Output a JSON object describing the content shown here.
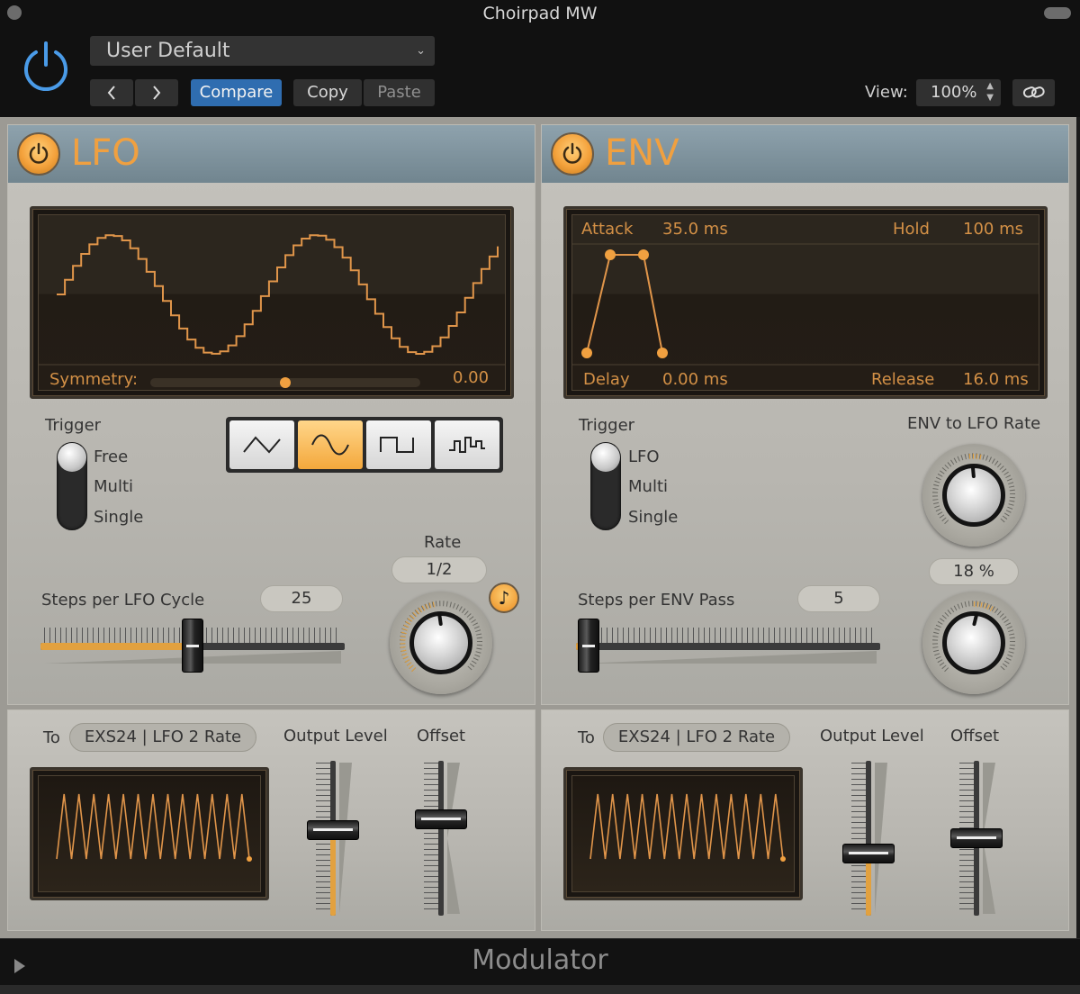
{
  "window": {
    "title": "Choirpad MW"
  },
  "header": {
    "preset": "User Default",
    "prev_icon": "chevron-left-icon",
    "next_icon": "chevron-right-icon",
    "compare_label": "Compare",
    "copy_label": "Copy",
    "paste_label": "Paste",
    "view_label": "View:",
    "zoom_value": "100%"
  },
  "lfo": {
    "title": "LFO",
    "symmetry_label": "Symmetry:",
    "symmetry_value": "0.00",
    "symmetry_position": 0.5,
    "trigger_label": "Trigger",
    "trigger_options": [
      "Free",
      "Multi",
      "Single"
    ],
    "trigger_selected": "Free",
    "waveforms": [
      "triangle-wave-icon",
      "sine-wave-icon",
      "square-wave-icon",
      "random-steps-icon"
    ],
    "waveform_selected": "sine-wave-icon",
    "rate_label": "Rate",
    "rate_value": "1/2",
    "sync_icon": "music-note-icon",
    "steps_label": "Steps per LFO Cycle",
    "steps_value": "25",
    "steps_fraction": 0.5
  },
  "env": {
    "title": "ENV",
    "attack_label": "Attack",
    "attack_value": "35.0 ms",
    "hold_label": "Hold",
    "hold_value": "100 ms",
    "delay_label": "Delay",
    "delay_value": "0.00 ms",
    "release_label": "Release",
    "release_value": "16.0 ms",
    "trigger_label": "Trigger",
    "trigger_options": [
      "LFO",
      "Multi",
      "Single"
    ],
    "trigger_selected": "LFO",
    "env_to_lfo_label": "ENV to LFO Rate",
    "env_to_lfo_value": "18 %",
    "steps_label": "Steps per ENV Pass",
    "steps_value": "5",
    "steps_fraction": 0.04
  },
  "outputs": {
    "lfo": {
      "to_label": "To",
      "target": "EXS24 | LFO 2 Rate",
      "output_level_label": "Output Level",
      "offset_label": "Offset",
      "output_level": 0.55,
      "offset": 0.62
    },
    "env": {
      "to_label": "To",
      "target": "EXS24 | LFO 2 Rate",
      "output_level_label": "Output Level",
      "offset_label": "Offset",
      "output_level": 0.4,
      "offset": 0.5
    }
  },
  "footer": {
    "title": "Modulator"
  },
  "colors": {
    "accent": "#f0a040",
    "compare_blue": "#2f6db0",
    "display_bg": "#1a1612"
  }
}
